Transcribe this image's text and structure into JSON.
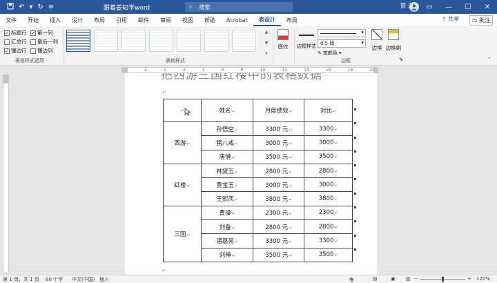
{
  "titlebar": {
    "doc_title": "跟着姜知学word",
    "search_placeholder": "搜索",
    "user_name": "赞 王",
    "avatar_initials": "赞王",
    "undo_icon": "undo-icon",
    "redo_icon": "redo-icon"
  },
  "tabs": [
    "文件",
    "开始",
    "插入",
    "设计",
    "布局",
    "引用",
    "邮件",
    "审阅",
    "视图",
    "帮助",
    "Acrobat",
    "表设计",
    "布局"
  ],
  "active_tab": "表设计",
  "share_label": "共享",
  "comment_label": "批注",
  "ribbon": {
    "options": [
      {
        "label": "标题行",
        "checked": true
      },
      {
        "label": "汇总行",
        "checked": false
      },
      {
        "label": "镶边行",
        "checked": true
      },
      {
        "label": "第一列",
        "checked": true
      },
      {
        "label": "最后一列",
        "checked": false
      },
      {
        "label": "镶边列",
        "checked": false
      }
    ],
    "group_options_label": "表格样式选项",
    "group_styles_label": "表格样式",
    "shading_label": "底纹",
    "border_styles_label": "边框样式",
    "pen_weight": "0.5 磅",
    "pen_color_label": "笔颜色",
    "borders_label": "边框",
    "border_painter_label": "边框刷",
    "group_borders_label": "边框"
  },
  "ruler_ticks": [
    "4",
    "2",
    "1",
    "2",
    "4",
    "6",
    "8",
    "10",
    "12",
    "14",
    "16",
    "18",
    "20"
  ],
  "document": {
    "heading": "把西游三国红楼中的表格数据",
    "table": {
      "headers": [
        "",
        "姓名",
        "月度绩效",
        "对比"
      ],
      "groups": [
        {
          "name": "西游",
          "rows": [
            [
              "孙悟空",
              "3300 元",
              "3300"
            ],
            [
              "猪八戒",
              "3000 元",
              "3000"
            ],
            [
              "唐僧",
              "3500 元",
              "3500"
            ]
          ]
        },
        {
          "name": "红楼",
          "rows": [
            [
              "林黛玉",
              "2800 元",
              "2800"
            ],
            [
              "贾宝玉",
              "3000 元",
              "3000"
            ],
            [
              "王熙凤",
              "3800 元",
              "3800"
            ]
          ]
        },
        {
          "name": "三国",
          "rows": [
            [
              "曹操",
              "2300 元",
              "2300"
            ],
            [
              "刘备",
              "2800 元",
              "2800"
            ],
            [
              "诸葛亮",
              "3300 元",
              "3300"
            ],
            [
              "刘禅",
              "3500 元",
              "3500"
            ]
          ]
        }
      ]
    }
  },
  "status": {
    "page": "第 1 页，共 1 页",
    "words": "80 个字",
    "language": "中文(中国)",
    "mode": "插入",
    "focus": "专注",
    "zoom": "120%"
  }
}
